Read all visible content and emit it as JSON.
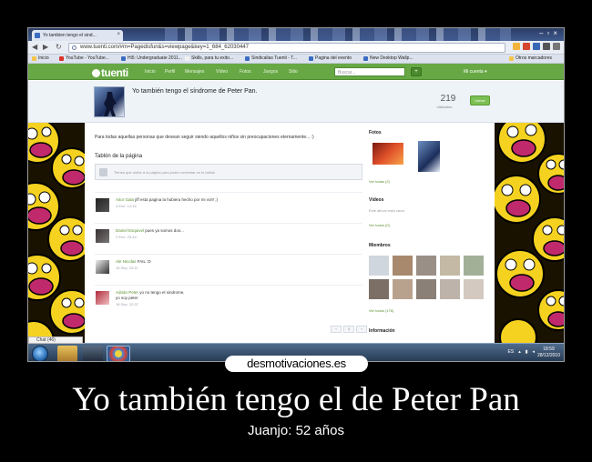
{
  "browser": {
    "tab_title": "Yo tambien tengo el sind...",
    "url": "www.tuenti.com/#m=Pagedisfun&s=viewpage&key=1_684_62030447",
    "bookmarks": [
      {
        "label": "Inicio",
        "color": "#f3c64a"
      },
      {
        "label": "YouTube - YouTube...",
        "color": "#d8322a"
      },
      {
        "label": "Hi5: Undergraduate 2011...",
        "color": "#3b6cc0"
      },
      {
        "label": "Skills, para tu exito...",
        "color": "#f1f1f1"
      },
      {
        "label": "Sindicalias Tuenti - T...",
        "color": "#3b6cc0"
      },
      {
        "label": "Pagina del evento",
        "color": "#3b6cc0"
      },
      {
        "label": "New Desktop Wallp...",
        "color": "#3b6cc0"
      },
      {
        "label": "Otros marcadores",
        "color": "#f3c64a"
      }
    ]
  },
  "tuenti": {
    "logo": "tuenti",
    "nav": [
      "Inicio",
      "Perfil",
      "Mensajes",
      "Vídeo",
      "Fotos",
      "Juegos",
      "Sitio"
    ],
    "search_placeholder": "Buscar...",
    "user_menu": "Mi cuenta ▾"
  },
  "profile": {
    "name": "Yo también tengo el síndrome de Peter Pan.",
    "visits": "219",
    "visits_label": "visitantes",
    "add_button": "Unirse"
  },
  "main": {
    "about": "Para todas aquellas personas que desean seguir siendo aquellos niños sin preocupaciones eternamente... :)",
    "board_title": "Tablón de la página",
    "board_placeholder": "Tienes que unirte a la página para poder contestar en el tablón",
    "posts": [
      {
        "author": "Aitor Gala",
        "text": "jiff esta pagina la hubiera hecho por mi vol!! ;)",
        "text2": "",
        "date": "4 Ene. 14:16"
      },
      {
        "author": "Daniel Esquivel",
        "text": "pues ya somos dos...",
        "text2": "",
        "date": "2 Ene. 20:44"
      },
      {
        "author": "Ale Nicolas",
        "text": "FAIL :D",
        "text2": "",
        "date": "18 Sep. 20:11"
      },
      {
        "author": "Adrián Peter",
        "text": "yo no tengo el sindrome,",
        "text2": "yo soy peter",
        "date": "18 Sep. 22:37"
      }
    ],
    "pager": [
      "‹",
      "1",
      "›"
    ]
  },
  "sidebar": {
    "photos_title": "Fotos",
    "photos_link": "Ver todas (2)",
    "videos_title": "Vídeos",
    "videos_text": "Este álbum está vacío",
    "videos_link": "Ver todos (0)",
    "members_title": "Miembros",
    "members_link": "Ver todos (176)",
    "info_title": "Información"
  },
  "taskbar": {
    "chat": "Chat (46)",
    "tray": "ES",
    "time": "18:59",
    "date": "28/12/2010"
  },
  "caption": {
    "site": "desmotivaciones.es",
    "title": "Yo también tengo el de Peter Pan",
    "subtitle": "Juanjo: 52 años"
  }
}
